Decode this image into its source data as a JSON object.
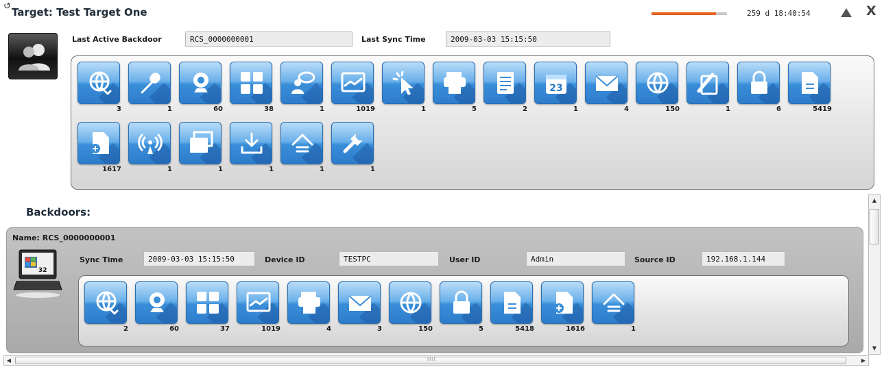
{
  "header": {
    "title": "Target: Test Target One",
    "progress_fraction": 0.85,
    "uptime": "259 d 18:40:54"
  },
  "target": {
    "last_active_backdoor_label": "Last Active Backdoor",
    "last_active_backdoor_value": "RCS_0000000001",
    "last_sync_label": "Last Sync Time",
    "last_sync_value": "2009-03-03 15:15:50",
    "evidence": [
      {
        "icon": "globe-phone-icon",
        "count": "3"
      },
      {
        "icon": "microphone-icon",
        "count": "1"
      },
      {
        "icon": "webcam-icon",
        "count": "60"
      },
      {
        "icon": "keyboard-keys-icon",
        "count": "38"
      },
      {
        "icon": "chat-user-icon",
        "count": "1"
      },
      {
        "icon": "screenshot-icon",
        "count": "1019"
      },
      {
        "icon": "mouse-click-icon",
        "count": "1"
      },
      {
        "icon": "printer-icon",
        "count": "5"
      },
      {
        "icon": "addressbook-icon",
        "count": "2"
      },
      {
        "icon": "calendar-icon",
        "count": "1"
      },
      {
        "icon": "mail-icon",
        "count": "4"
      },
      {
        "icon": "url-globe-icon",
        "count": "150"
      },
      {
        "icon": "clipboard-icon",
        "count": "1"
      },
      {
        "icon": "password-lock-icon",
        "count": "6"
      },
      {
        "icon": "document-icon",
        "count": "5419"
      },
      {
        "icon": "file-add-icon",
        "count": "1617"
      },
      {
        "icon": "wireless-icon",
        "count": "1"
      },
      {
        "icon": "windows-stack-icon",
        "count": "1"
      },
      {
        "icon": "download-icon",
        "count": "1"
      },
      {
        "icon": "upload-icon",
        "count": "1"
      },
      {
        "icon": "tools-icon",
        "count": "1"
      }
    ]
  },
  "backdoors": {
    "heading": "Backdoors:",
    "items": [
      {
        "name": "Name: RCS_0000000001",
        "laptop_badge": "32",
        "sync_time_label": "Sync Time",
        "sync_time_value": "2009-03-03 15:15:50",
        "device_id_label": "Device ID",
        "device_id_value": "TESTPC",
        "user_id_label": "User ID",
        "user_id_value": "Admin",
        "source_id_label": "Source ID",
        "source_id_value": "192.168.1.144",
        "evidence": [
          {
            "icon": "globe-phone-icon",
            "count": "2"
          },
          {
            "icon": "webcam-icon",
            "count": "60"
          },
          {
            "icon": "keyboard-keys-icon",
            "count": "37"
          },
          {
            "icon": "screenshot-icon",
            "count": "1019"
          },
          {
            "icon": "printer-icon",
            "count": "4"
          },
          {
            "icon": "mail-icon",
            "count": "3"
          },
          {
            "icon": "url-globe-icon",
            "count": "150"
          },
          {
            "icon": "password-lock-icon",
            "count": "5"
          },
          {
            "icon": "document-icon",
            "count": "5418"
          },
          {
            "icon": "file-add-icon",
            "count": "1616"
          },
          {
            "icon": "upload-icon",
            "count": "1"
          }
        ]
      }
    ]
  }
}
